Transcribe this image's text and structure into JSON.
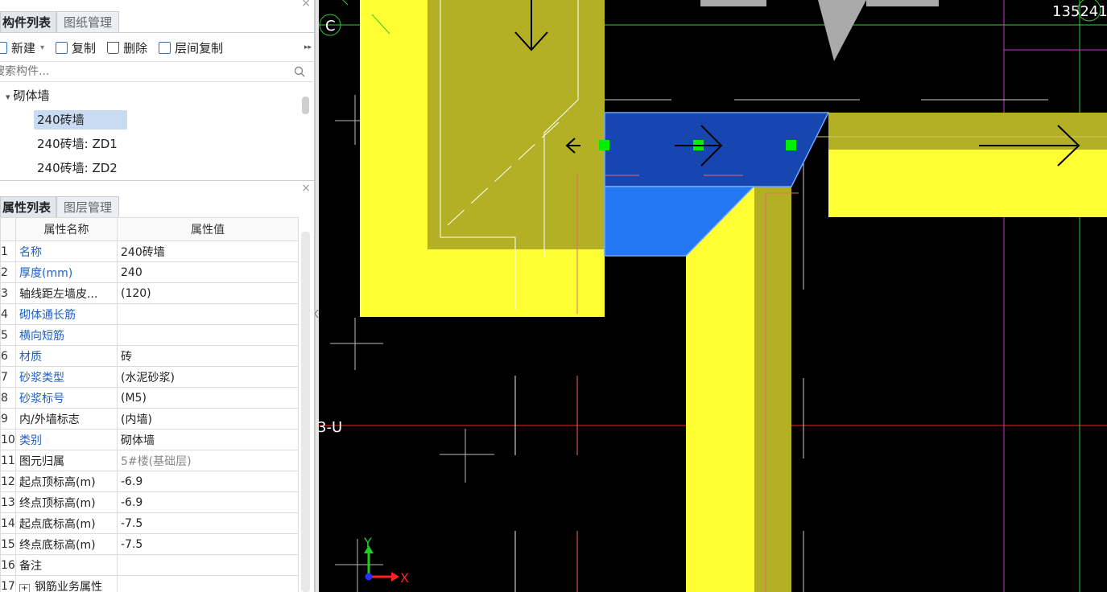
{
  "component_panel": {
    "close_glyph": "×",
    "tabs": [
      "构件列表",
      "图纸管理"
    ],
    "toolbar": {
      "new_label": "新建",
      "new_caret": "▾",
      "copy_label": "复制",
      "delete_label": "删除",
      "floor_copy_label": "层间复制",
      "overflow": "▸▸"
    },
    "search_placeholder": "搜索构件...",
    "tree": {
      "group_caret": "▾",
      "group": "砌体墙",
      "items": [
        "240砖墙",
        "240砖墙: ZD1",
        "240砖墙: ZD2"
      ]
    }
  },
  "property_panel": {
    "close_glyph": "×",
    "tabs": [
      "属性列表",
      "图层管理"
    ],
    "columns": [
      "属性名称",
      "属性值"
    ],
    "rows": [
      {
        "num": "1",
        "name": "名称",
        "value": "240砖墙"
      },
      {
        "num": "2",
        "name": "厚度(mm)",
        "value": "240"
      },
      {
        "num": "3",
        "name": "轴线距左墙皮...",
        "value": "(120)"
      },
      {
        "num": "4",
        "name": "砌体通长筋",
        "value": ""
      },
      {
        "num": "5",
        "name": "横向短筋",
        "value": ""
      },
      {
        "num": "6",
        "name": "材质",
        "value": "砖"
      },
      {
        "num": "7",
        "name": "砂浆类型",
        "value": "(水泥砂浆)"
      },
      {
        "num": "8",
        "name": "砂浆标号",
        "value": "(M5)"
      },
      {
        "num": "9",
        "name": "内/外墙标志",
        "value": "(内墙)"
      },
      {
        "num": "10",
        "name": "类别",
        "value": "砌体墙"
      },
      {
        "num": "11",
        "name": "图元归属",
        "value": "5#楼(基础层)"
      },
      {
        "num": "12",
        "name": "起点顶标高(m)",
        "value": "-6.9"
      },
      {
        "num": "13",
        "name": "终点顶标高(m)",
        "value": "-6.9"
      },
      {
        "num": "14",
        "name": "起点底标高(m)",
        "value": "-7.5"
      },
      {
        "num": "15",
        "name": "终点底标高(m)",
        "value": "-7.5"
      },
      {
        "num": "16",
        "name": "备注",
        "value": ""
      },
      {
        "num": "17",
        "name": "钢筋业务属性",
        "value": ""
      }
    ],
    "expand_glyph": "+"
  },
  "canvas": {
    "axis_label_c": "C",
    "axis_label_3u": "3-U",
    "top_right_label": "135241",
    "origin_y": "Y",
    "origin_x": "X",
    "colors": {
      "background": "#000000",
      "wall_yellow": "#ffff33",
      "wall_olive": "#b3b026",
      "selected_dark": "#1846b0",
      "selected_light": "#2377f5",
      "grip": "#00ee00",
      "axis_red": "#ff2020",
      "axis_green": "#33cc33",
      "magenta": "#cc33cc"
    }
  }
}
